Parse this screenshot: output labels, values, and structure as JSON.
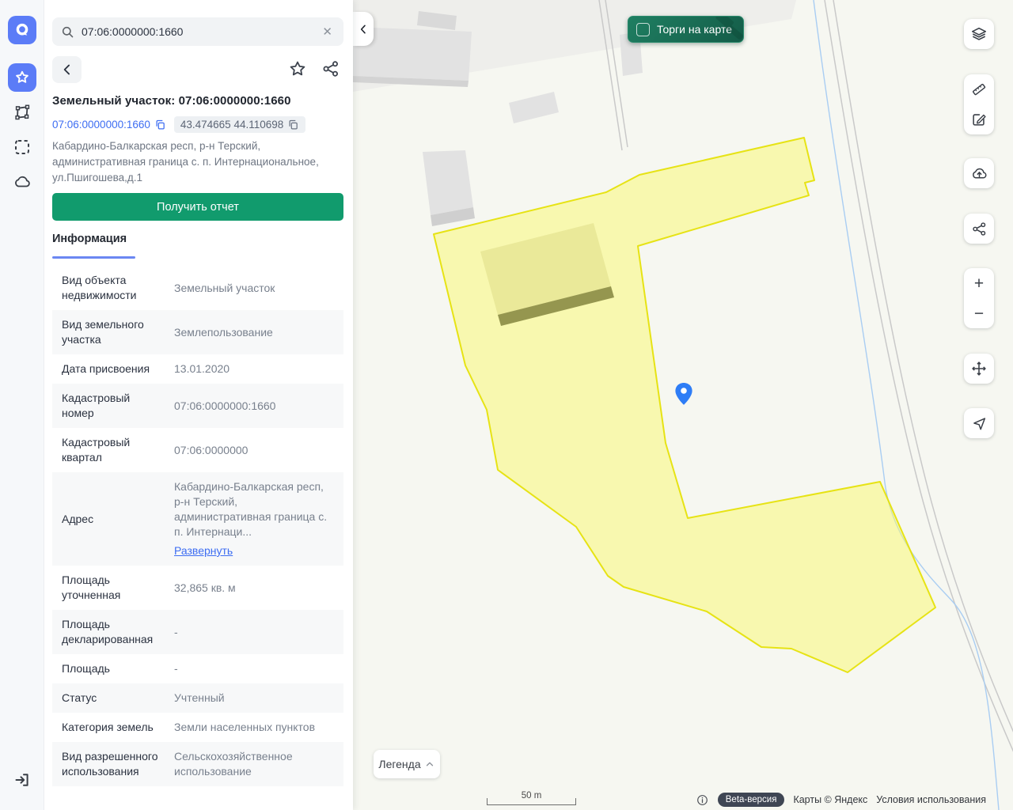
{
  "search": {
    "value": "07:06:0000000:1660"
  },
  "panel": {
    "title": "Земельный участок: 07:06:0000000:1660",
    "cadastral_link": "07:06:0000000:1660",
    "coords_chip": "43.474665 44.110698",
    "address": "Кабардино-Балкарская респ, р-н Терский, административная граница с. п. Интернациональное, ул.Пшигошева,д.1",
    "report_button": "Получить отчет",
    "tab": "Информация",
    "rows": [
      {
        "label": "Вид объекта недвижимости",
        "value": "Земельный участок"
      },
      {
        "label": "Вид земельного участка",
        "value": "Землепользование"
      },
      {
        "label": "Дата присвоения",
        "value": "13.01.2020"
      },
      {
        "label": "Кадастровый номер",
        "value": "07:06:0000000:1660"
      },
      {
        "label": "Кадастровый квартал",
        "value": "07:06:0000000"
      },
      {
        "label": "Адрес",
        "value": "Кабардино-Балкарская респ, р-н Терский, административная граница с. п. Интернаци...",
        "link": "Развернуть"
      },
      {
        "label": "Площадь уточненная",
        "value": "32,865 кв. м"
      },
      {
        "label": "Площадь декларированная",
        "value": "-"
      },
      {
        "label": "Площадь",
        "value": "-"
      },
      {
        "label": "Статус",
        "value": "Учтенный"
      },
      {
        "label": "Категория земель",
        "value": "Земли населенных пунктов"
      },
      {
        "label": "Вид разрешенного использования",
        "value": "Сельскохозяйственное использование"
      }
    ]
  },
  "map": {
    "auction_toggle": "Торги на карте",
    "legend_button": "Легенда",
    "scale_label": "50 m",
    "attribution": {
      "beta": "Beta-версия",
      "copyright": "Карты © Яндекс",
      "terms": "Условия использования"
    }
  },
  "icons": {
    "clear": "✕",
    "zoom_in": "+",
    "zoom_out": "−"
  },
  "colors": {
    "accent_blue": "#5b7cf7",
    "link_blue": "#3d6df2",
    "report_green": "#119b6d",
    "auction_green": "#17604b",
    "parcel_fill": "#fafa6e",
    "parcel_stroke": "#e4e000",
    "pin_blue": "#2e7df6"
  }
}
